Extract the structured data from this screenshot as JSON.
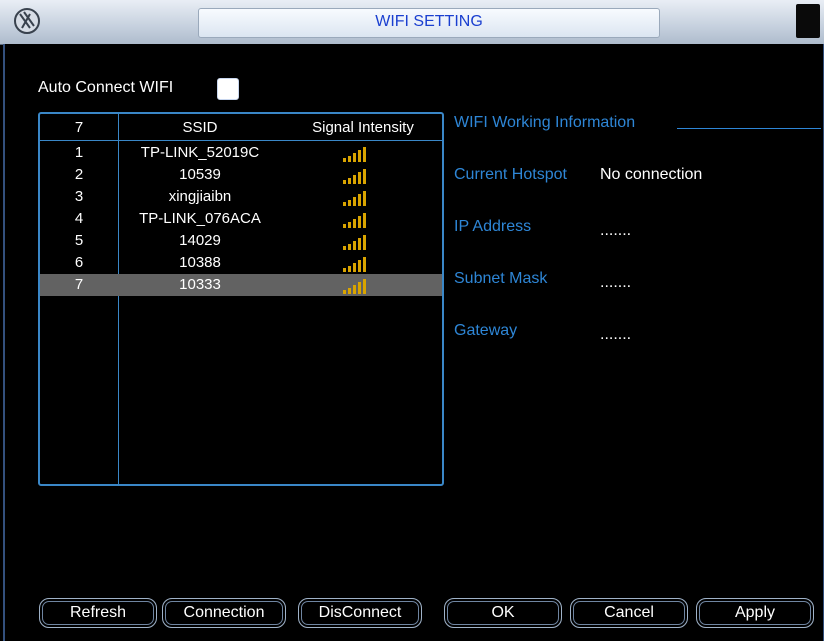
{
  "window": {
    "title": "WIFI SETTING"
  },
  "auto_connect": {
    "label": "Auto Connect WIFI",
    "checked": false
  },
  "list": {
    "headers": {
      "count": "7",
      "ssid": "SSID",
      "signal": "Signal Intensity"
    },
    "rows": [
      {
        "num": "1",
        "ssid": "TP-LINK_52019C"
      },
      {
        "num": "2",
        "ssid": "10539"
      },
      {
        "num": "3",
        "ssid": "xingjiaibn"
      },
      {
        "num": "4",
        "ssid": "TP-LINK_076ACA"
      },
      {
        "num": "5",
        "ssid": "14029"
      },
      {
        "num": "6",
        "ssid": "10388"
      },
      {
        "num": "7",
        "ssid": "10333"
      }
    ],
    "selected_index": 6
  },
  "info": {
    "title": "WIFI Working Information",
    "current_hotspot_label": "Current Hotspot",
    "current_hotspot_value": "No connection",
    "ip_label": "IP Address",
    "ip_value": ".......",
    "subnet_label": "Subnet Mask",
    "subnet_value": ".......",
    "gateway_label": "Gateway",
    "gateway_value": "......."
  },
  "buttons": {
    "refresh": "Refresh",
    "connection": "Connection",
    "disconnect": "DisConnect",
    "ok": "OK",
    "cancel": "Cancel",
    "apply": "Apply"
  },
  "colors": {
    "accent": "#2e86d6",
    "signal_bars": "#d9a400",
    "title_text": "#1a3fd0"
  },
  "icons": {
    "logo": "app-logo-icon",
    "signal": "signal-bars-icon"
  }
}
